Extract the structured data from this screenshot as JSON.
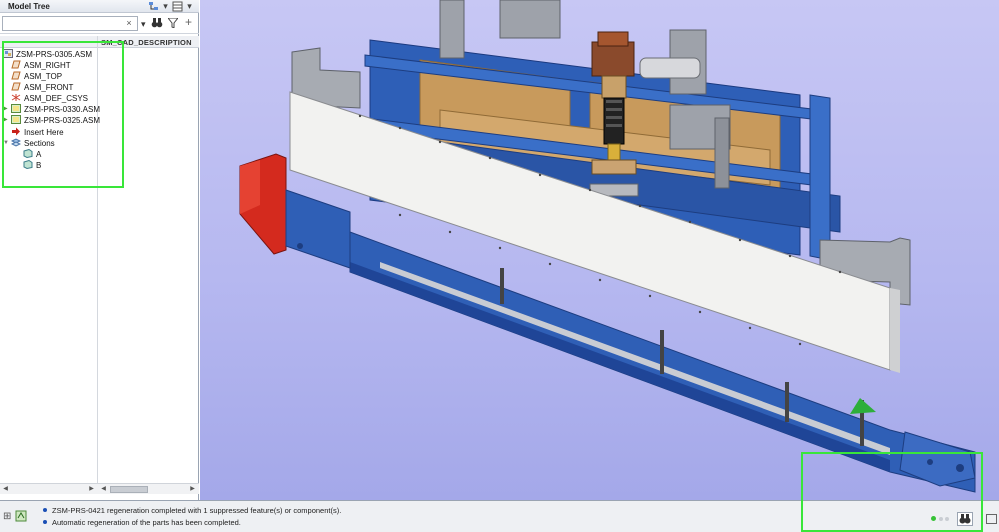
{
  "model_tree": {
    "title": "Model Tree",
    "search_placeholder": "",
    "clear_glyph": "×",
    "column_header": "SM_CAD_DESCRIPTION",
    "items": [
      {
        "label": "ZSM-PRS-0305.ASM",
        "icon": "assembly-icon"
      },
      {
        "label": "ASM_RIGHT",
        "icon": "datum-plane-icon"
      },
      {
        "label": "ASM_TOP",
        "icon": "datum-plane-icon"
      },
      {
        "label": "ASM_FRONT",
        "icon": "datum-plane-icon"
      },
      {
        "label": "ASM_DEF_CSYS",
        "icon": "csys-icon"
      },
      {
        "label": "ZSM-PRS-0330.ASM",
        "icon": "subassembly-icon"
      },
      {
        "label": "ZSM-PRS-0325.ASM",
        "icon": "subassembly-icon"
      },
      {
        "label": "Insert Here",
        "icon": "insert-arrow-icon"
      },
      {
        "label": "Sections",
        "icon": "sections-icon"
      },
      {
        "label": "A",
        "icon": "section-icon"
      },
      {
        "label": "B",
        "icon": "section-icon"
      }
    ]
  },
  "status": {
    "messages": [
      "ZSM-PRS-0421 regeneration completed with 1 suppressed feature(s) or component(s).",
      "Automatic regeneration of the parts has been completed."
    ]
  },
  "colors": {
    "highlight": "#39e639",
    "viewport_background": "#b6b8f0",
    "frame_blue": "#3a64b8",
    "wood": "#c89a5c",
    "panel_white": "#f2f2f0",
    "red_guard": "#d42a1e"
  }
}
